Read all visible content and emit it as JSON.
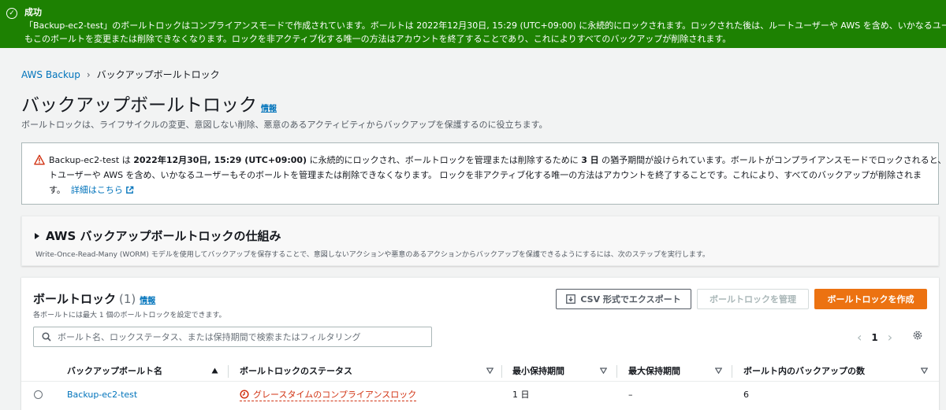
{
  "flash": {
    "title": "成功",
    "message_line1": "「Backup-ec2-test」のボールトロックはコンプライアンスモードで作成されています。ボールトは 2022年12月30日, 15:29 (UTC+09:00) に永続的にロックされます。ロックされた後は、ルートユーザーや AWS を含め、いかなるユーザー",
    "message_line2": "もこのボールトを変更または削除できなくなります。ロックを非アクティブ化する唯一の方法はアカウントを終了することであり、これによりすべてのバックアップが削除されます。"
  },
  "breadcrumb": {
    "root": "AWS Backup",
    "current": "バックアップボールトロック"
  },
  "page": {
    "title": "バックアップボールトロック",
    "info": "情報",
    "description": "ボールトロックは、ライフサイクルの変更、意図しない削除、悪意のあるアクティビティからバックアップを保護するのに役立ちます。"
  },
  "alert": {
    "part1": "Backup-ec2-test は ",
    "date": "2022年12月30日, 15:29 (UTC+09:00)",
    "part2": " に永続的にロックされ、ボールトロックを管理または削除するために ",
    "days": "3 日",
    "part3": " の猶予期間が設けられています。ボールトがコンプライアンスモードでロックされると、ルー",
    "line2": "トユーザーや AWS を含め、いかなるユーザーもそのボールトを管理または削除できなくなります。 ロックを非アクティブ化する唯一の方法はアカウントを終了することです。これにより、すべてのバックアップが削除されま",
    "line3": "す。",
    "link": "詳細はこちら"
  },
  "howto": {
    "title": "AWS バックアップボールトロックの仕組み",
    "description": "Write-Once-Read-Many (WORM) モデルを使用してバックアップを保存することで、意図しないアクションや悪意のあるアクションからバックアップを保護できるようにするには、次のステップを実行します。"
  },
  "panel": {
    "title": "ボールトロック",
    "count": "(1)",
    "info": "情報",
    "subtitle": "各ボールトには最大 1 個のボールトロックを設定できます。",
    "export_label": "CSV 形式でエクスポート",
    "manage_label": "ボールトロックを管理",
    "create_label": "ボールトロックを作成",
    "search_placeholder": "ボールト名、ロックステータス、または保持期間で検索またはフィルタリング",
    "page_number": "1"
  },
  "table": {
    "columns": [
      "バックアップボールト名",
      "ボールトロックのステータス",
      "最小保持期間",
      "最大保持期間",
      "ボールト内のバックアップの数"
    ],
    "rows": [
      {
        "vault": "Backup-ec2-test",
        "status": "グレースタイムのコンプライアンスロック",
        "min": "1 日",
        "max": "–",
        "count": "6"
      }
    ]
  },
  "colors": {
    "success": "#1d8102",
    "primary": "#ec7211",
    "link": "#0073bb",
    "error": "#d13212"
  }
}
